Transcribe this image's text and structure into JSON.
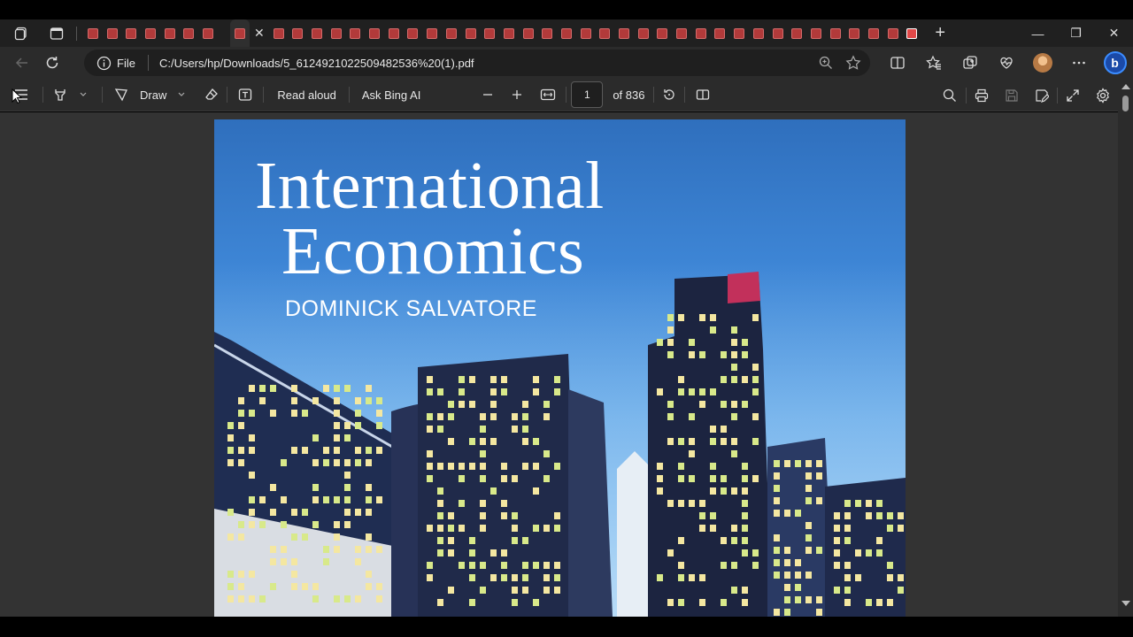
{
  "browser": {
    "tab_count_left": 7,
    "tab_count_right": 34,
    "active_tab_close": "✕",
    "new_tab": "+",
    "window": {
      "minimize": "—",
      "restore": "❐",
      "close": "✕"
    },
    "address": {
      "scheme_label": "File",
      "url": "C:/Users/hp/Downloads/5_6124921022509482536%20(1).pdf"
    }
  },
  "pdf_toolbar": {
    "draw_label": "Draw",
    "read_aloud_label": "Read aloud",
    "ask_bing_label": "Ask Bing AI",
    "current_page": "1",
    "page_total_label": "of 836"
  },
  "document": {
    "title_line1": "International",
    "title_line2": "Economics",
    "author": "DOMINICK SALVATORE"
  },
  "colors": {
    "tab_strip": "#202020",
    "toolbar": "#2b2b2b",
    "viewer_bg": "#333333",
    "pdf_favicon": "#b23a3a",
    "sky": "#3e86d6"
  }
}
